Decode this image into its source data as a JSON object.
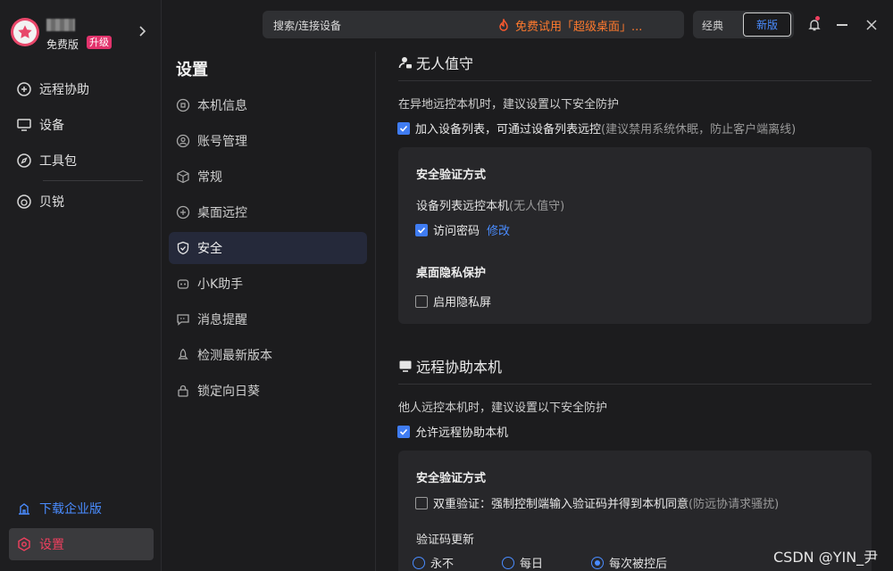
{
  "profile": {
    "plan": "免费版",
    "upgrade": "升级"
  },
  "sidebar": {
    "items": [
      {
        "label": "远程协助"
      },
      {
        "label": "设备"
      },
      {
        "label": "工具包"
      },
      {
        "label": "贝锐"
      }
    ],
    "download": "下载企业版",
    "settings": "设置"
  },
  "topbar": {
    "search_label": "搜索/连接设备",
    "promo": "免费试用「超级桌面」...",
    "mode_classic": "经典",
    "mode_new": "新版"
  },
  "settings_menu": {
    "title": "设置",
    "items": [
      "本机信息",
      "账号管理",
      "常规",
      "桌面远控",
      "安全",
      "小K助手",
      "消息提醒",
      "检测最新版本",
      "锁定向日葵"
    ],
    "active_index": 4
  },
  "unattended": {
    "title": "无人值守",
    "hint": "在异地远控本机时，建议设置以下安全防护",
    "add_to_list": "加入设备列表，可通过设备列表远控",
    "add_to_list_note": "(建议禁用系统休眠，防止客户端离线)",
    "add_to_list_checked": true,
    "card": {
      "verify_title": "安全验证方式",
      "device_list_label": "设备列表远控本机",
      "device_list_note": "(无人值守)",
      "access_password": "访问密码",
      "access_password_checked": true,
      "modify": "修改",
      "privacy_title": "桌面隐私保护",
      "privacy_screen": "启用隐私屏",
      "privacy_screen_checked": false
    }
  },
  "assist": {
    "title": "远程协助本机",
    "hint": "他人远控本机时，建议设置以下安全防护",
    "allow": "允许远程协助本机",
    "allow_checked": true,
    "card": {
      "verify_title": "安全验证方式",
      "double_verify": "双重验证：强制控制端输入验证码并得到本机同意",
      "double_verify_note": "(防远协请求骚扰)",
      "double_verify_checked": false,
      "code_update_title": "验证码更新",
      "options": [
        "永不",
        "每日",
        "每次被控后"
      ],
      "selected_option": 2
    }
  },
  "watermark": "CSDN @YIN_尹",
  "colors": {
    "accent": "#3f7cf2",
    "brand": "#e8476a",
    "promo": "#ff7a2e"
  }
}
